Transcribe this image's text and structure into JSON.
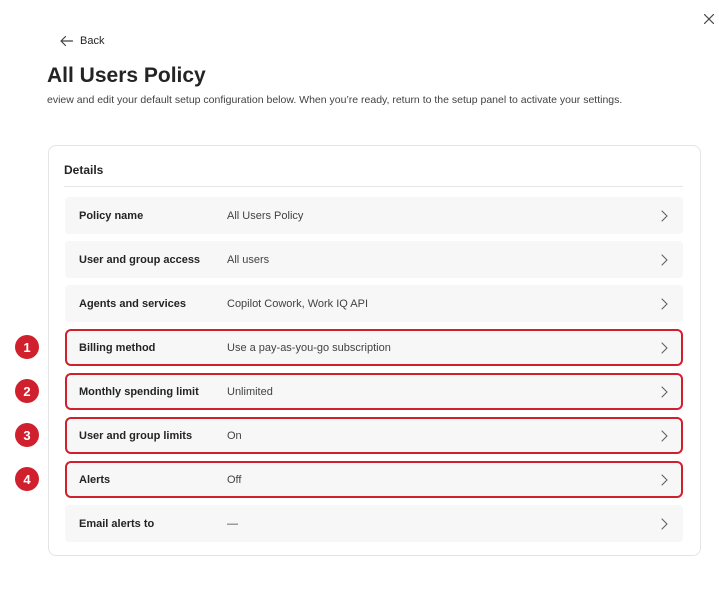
{
  "window": {
    "close_icon": "close-icon"
  },
  "nav": {
    "back_label": "Back",
    "back_icon": "arrow-left-icon"
  },
  "page": {
    "title": "All Users Policy",
    "subtitle": "eview and edit your default setup configuration below. When you’re ready, return to the setup panel to activate your settings."
  },
  "details": {
    "section_title": "Details",
    "rows": [
      {
        "label": "Policy name",
        "value": "All Users Policy",
        "highlighted": false,
        "badge": ""
      },
      {
        "label": "User and group access",
        "value": "All users",
        "highlighted": false,
        "badge": ""
      },
      {
        "label": "Agents and services",
        "value": "Copilot Cowork, Work IQ API",
        "highlighted": false,
        "badge": ""
      },
      {
        "label": "Billing method",
        "value": "Use a pay-as-you-go subscription",
        "highlighted": true,
        "badge": "1"
      },
      {
        "label": "Monthly spending limit",
        "value": "Unlimited",
        "highlighted": true,
        "badge": "2"
      },
      {
        "label": "User and group limits",
        "value": "On",
        "highlighted": true,
        "badge": "3"
      },
      {
        "label": "Alerts",
        "value": "Off",
        "highlighted": true,
        "badge": "4"
      },
      {
        "label": "Email alerts to",
        "value": "—",
        "highlighted": false,
        "badge": ""
      }
    ]
  },
  "colors": {
    "highlight": "#d0202e",
    "row_background": "#f7f7f7",
    "text_primary": "#242424"
  }
}
